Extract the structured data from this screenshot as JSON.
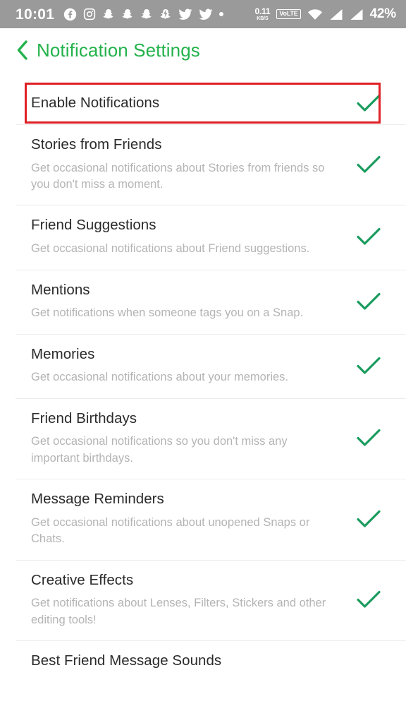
{
  "status_bar": {
    "time": "10:01",
    "left_icons": [
      "facebook-icon",
      "instagram-icon",
      "snapchat-icon",
      "snapchat-icon",
      "snapchat-icon",
      "snapchat-bolt-icon",
      "twitter-icon",
      "twitter-icon",
      "more-dot-icon"
    ],
    "network_speed_value": "0.11",
    "network_speed_unit": "KB/S",
    "volte_label": "VoLTE",
    "right_icons": [
      "wifi-icon",
      "signal-bars-icon",
      "signal-bars-icon"
    ],
    "battery": "42%",
    "background_color": "#9a9a9a"
  },
  "header": {
    "back_label": "‹",
    "title": "Notification Settings",
    "title_color": "#24b24c"
  },
  "theme": {
    "check_color": "#1a9c5e",
    "highlight_color": "#e02027",
    "title_color": "#2b2b2b",
    "desc_color": "#b4b4b4",
    "divider_color": "#ededed"
  },
  "settings": [
    {
      "title": "Enable Notifications",
      "desc": "",
      "checked": true,
      "highlighted": true
    },
    {
      "title": "Stories from Friends",
      "desc": "Get occasional notifications about Stories from friends so you don't miss a moment.",
      "checked": true,
      "highlighted": false
    },
    {
      "title": "Friend Suggestions",
      "desc": "Get occasional notifications about Friend suggestions.",
      "checked": true,
      "highlighted": false
    },
    {
      "title": "Mentions",
      "desc": "Get notifications when someone tags you on a Snap.",
      "checked": true,
      "highlighted": false
    },
    {
      "title": "Memories",
      "desc": "Get occasional notifications about your memories.",
      "checked": true,
      "highlighted": false
    },
    {
      "title": "Friend Birthdays",
      "desc": "Get occasional notifications so you don't miss any important birthdays.",
      "checked": true,
      "highlighted": false
    },
    {
      "title": "Message Reminders",
      "desc": "Get occasional notifications about unopened Snaps or Chats.",
      "checked": true,
      "highlighted": false
    },
    {
      "title": "Creative Effects",
      "desc": "Get notifications about Lenses, Filters, Stickers and other editing tools!",
      "checked": true,
      "highlighted": false
    },
    {
      "title": "Best Friend Message Sounds",
      "desc": "",
      "checked": false,
      "highlighted": false
    }
  ]
}
